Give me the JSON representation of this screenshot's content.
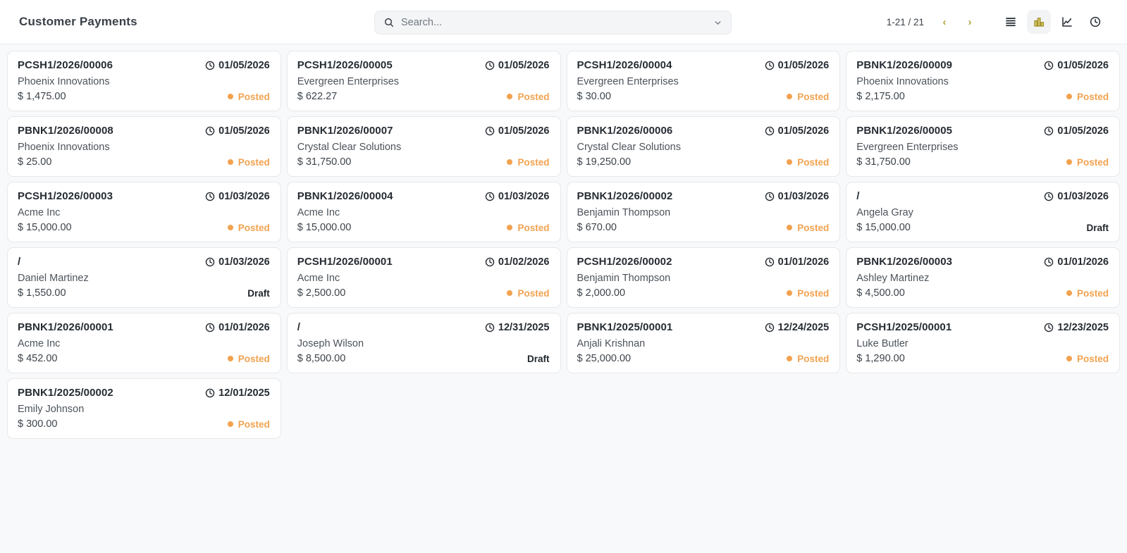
{
  "header": {
    "title": "Customer Payments",
    "search": {
      "placeholder": "Search..."
    },
    "pager": {
      "range": "1-21 / 21",
      "prev": "‹",
      "next": "›"
    },
    "views": [
      {
        "name": "list",
        "active": false
      },
      {
        "name": "kanban",
        "active": true
      },
      {
        "name": "graph",
        "active": false
      },
      {
        "name": "activity",
        "active": false
      }
    ]
  },
  "colors": {
    "accent_orange": "#f2a24f",
    "accent_olive": "#b4a237",
    "page_bg": "#f8f9fa"
  },
  "status_labels": {
    "posted": "Posted",
    "draft": "Draft"
  },
  "cards": [
    {
      "ref": "PCSH1/2026/00006",
      "date": "01/05/2026",
      "customer": "Phoenix Innovations",
      "amount": "$ 1,475.00",
      "status": "Posted"
    },
    {
      "ref": "PCSH1/2026/00005",
      "date": "01/05/2026",
      "customer": "Evergreen Enterprises",
      "amount": "$ 622.27",
      "status": "Posted"
    },
    {
      "ref": "PCSH1/2026/00004",
      "date": "01/05/2026",
      "customer": "Evergreen Enterprises",
      "amount": "$ 30.00",
      "status": "Posted"
    },
    {
      "ref": "PBNK1/2026/00009",
      "date": "01/05/2026",
      "customer": "Phoenix Innovations",
      "amount": "$ 2,175.00",
      "status": "Posted"
    },
    {
      "ref": "PBNK1/2026/00008",
      "date": "01/05/2026",
      "customer": "Phoenix Innovations",
      "amount": "$ 25.00",
      "status": "Posted"
    },
    {
      "ref": "PBNK1/2026/00007",
      "date": "01/05/2026",
      "customer": "Crystal Clear Solutions",
      "amount": "$ 31,750.00",
      "status": "Posted"
    },
    {
      "ref": "PBNK1/2026/00006",
      "date": "01/05/2026",
      "customer": "Crystal Clear Solutions",
      "amount": "$ 19,250.00",
      "status": "Posted"
    },
    {
      "ref": "PBNK1/2026/00005",
      "date": "01/05/2026",
      "customer": "Evergreen Enterprises",
      "amount": "$ 31,750.00",
      "status": "Posted"
    },
    {
      "ref": "PCSH1/2026/00003",
      "date": "01/03/2026",
      "customer": "Acme Inc",
      "amount": "$ 15,000.00",
      "status": "Posted"
    },
    {
      "ref": "PBNK1/2026/00004",
      "date": "01/03/2026",
      "customer": "Acme Inc",
      "amount": "$ 15,000.00",
      "status": "Posted"
    },
    {
      "ref": "PBNK1/2026/00002",
      "date": "01/03/2026",
      "customer": "Benjamin Thompson",
      "amount": "$ 670.00",
      "status": "Posted"
    },
    {
      "ref": "/",
      "date": "01/03/2026",
      "customer": "Angela Gray",
      "amount": "$ 15,000.00",
      "status": "Draft"
    },
    {
      "ref": "/",
      "date": "01/03/2026",
      "customer": "Daniel Martinez",
      "amount": "$ 1,550.00",
      "status": "Draft"
    },
    {
      "ref": "PCSH1/2026/00001",
      "date": "01/02/2026",
      "customer": "Acme Inc",
      "amount": "$ 2,500.00",
      "status": "Posted"
    },
    {
      "ref": "PCSH1/2026/00002",
      "date": "01/01/2026",
      "customer": "Benjamin Thompson",
      "amount": "$ 2,000.00",
      "status": "Posted"
    },
    {
      "ref": "PBNK1/2026/00003",
      "date": "01/01/2026",
      "customer": "Ashley Martinez",
      "amount": "$ 4,500.00",
      "status": "Posted"
    },
    {
      "ref": "PBNK1/2026/00001",
      "date": "01/01/2026",
      "customer": "Acme Inc",
      "amount": "$ 452.00",
      "status": "Posted"
    },
    {
      "ref": "/",
      "date": "12/31/2025",
      "customer": "Joseph Wilson",
      "amount": "$ 8,500.00",
      "status": "Draft"
    },
    {
      "ref": "PBNK1/2025/00001",
      "date": "12/24/2025",
      "customer": "Anjali Krishnan",
      "amount": "$ 25,000.00",
      "status": "Posted"
    },
    {
      "ref": "PCSH1/2025/00001",
      "date": "12/23/2025",
      "customer": "Luke Butler",
      "amount": "$ 1,290.00",
      "status": "Posted"
    },
    {
      "ref": "PBNK1/2025/00002",
      "date": "12/01/2025",
      "customer": "Emily Johnson",
      "amount": "$ 300.00",
      "status": "Posted"
    }
  ]
}
